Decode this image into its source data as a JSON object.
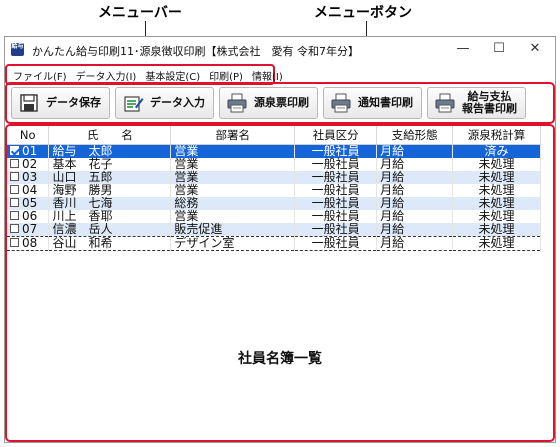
{
  "callouts": {
    "menubar": "メニューバー",
    "menubuttons": "メニューボタン"
  },
  "window": {
    "title": "かんたん給与印刷11･源泉徴収印刷【株式会社　愛有 令和7年分】",
    "app_icon_text": "給与",
    "minimize": "—",
    "maximize": "☐",
    "close": "✕"
  },
  "menu": {
    "items": [
      {
        "label": "ファイル(F)"
      },
      {
        "label": "データ入力(I)"
      },
      {
        "label": "基本設定(C)"
      },
      {
        "label": "印刷(P)"
      },
      {
        "label": "情報(I)"
      }
    ]
  },
  "toolbar": {
    "buttons": [
      {
        "label": "データ保存",
        "icon": "save-icon"
      },
      {
        "label": "データ入力",
        "icon": "data-entry-icon"
      },
      {
        "label": "源泉票印刷",
        "icon": "printer-icon"
      },
      {
        "label": "通知書印刷",
        "icon": "printer-icon"
      },
      {
        "label_line1": "給与支払",
        "label_line2": "報告書印刷",
        "icon": "printer-icon"
      }
    ]
  },
  "table": {
    "headers": [
      "No",
      "氏　　名",
      "部署名",
      "社員区分",
      "支給形態",
      "源泉税計算"
    ],
    "rows": [
      {
        "no": "01",
        "name": "給与　太郎",
        "dept": "営業",
        "category": "一般社員",
        "pay_type": "月給",
        "tax_calc": "済み",
        "checked": true
      },
      {
        "no": "02",
        "name": "基本　花子",
        "dept": "営業",
        "category": "一般社員",
        "pay_type": "月給",
        "tax_calc": "未処理",
        "checked": false
      },
      {
        "no": "03",
        "name": "山口　五郎",
        "dept": "営業",
        "category": "一般社員",
        "pay_type": "月給",
        "tax_calc": "未処理",
        "checked": false
      },
      {
        "no": "04",
        "name": "海野　勝男",
        "dept": "営業",
        "category": "一般社員",
        "pay_type": "月給",
        "tax_calc": "未処理",
        "checked": false
      },
      {
        "no": "05",
        "name": "香川　七海",
        "dept": "総務",
        "category": "一般社員",
        "pay_type": "月給",
        "tax_calc": "未処理",
        "checked": false
      },
      {
        "no": "06",
        "name": "川上　香耶",
        "dept": "営業",
        "category": "一般社員",
        "pay_type": "月給",
        "tax_calc": "未処理",
        "checked": false
      },
      {
        "no": "07",
        "name": "信濃　岳人",
        "dept": "販売促進",
        "category": "一般社員",
        "pay_type": "月給",
        "tax_calc": "未処理",
        "checked": false
      },
      {
        "no": "08",
        "name": "谷山　和希",
        "dept": "デザイン室",
        "category": "一般社員",
        "pay_type": "月給",
        "tax_calc": "未処理",
        "checked": false
      }
    ]
  },
  "list_caption": "社員名簿一覧",
  "colors": {
    "highlight_outline": "#e0112b",
    "selected_row": "#1565d8",
    "alt_row": "#dde9f8"
  }
}
